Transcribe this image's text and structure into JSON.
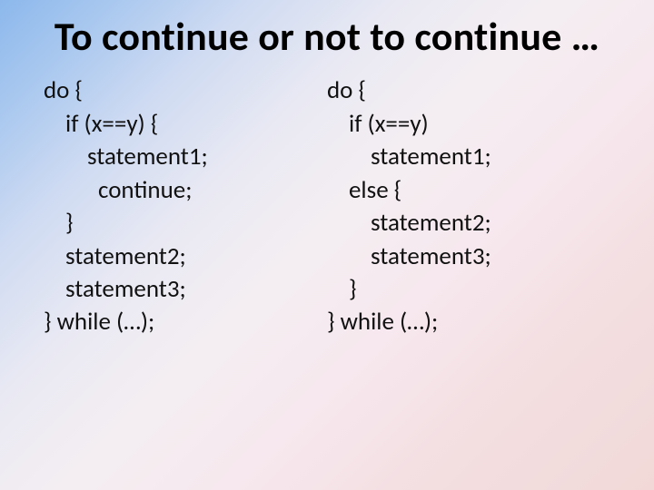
{
  "title": "To continue or not to continue …",
  "left": {
    "l0": "do {",
    "l1": "if (x==y) {",
    "l2": "statement1;",
    "l3": "continue;",
    "l4": "}",
    "l5": "statement2;",
    "l6": "statement3;",
    "l7": "} while (…);"
  },
  "right": {
    "l0": "do {",
    "l1": "if (x==y)",
    "l2": "statement1;",
    "l3": "else {",
    "l4": "statement2;",
    "l5": "statement3;",
    "l6": "}",
    "l7": "} while (…);"
  }
}
